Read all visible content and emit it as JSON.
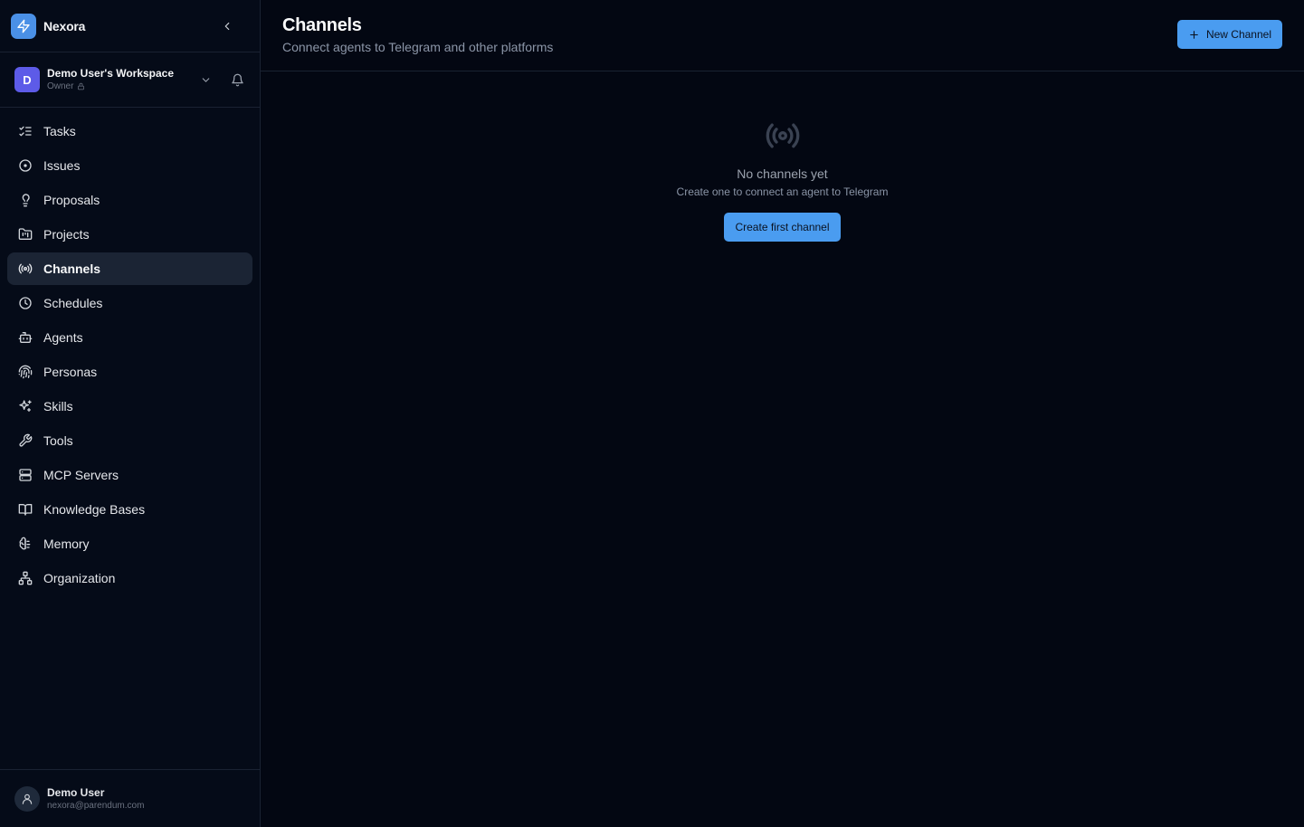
{
  "brand": {
    "name": "Nexora"
  },
  "workspace": {
    "name": "Demo User's Workspace",
    "role": "Owner",
    "initial": "D"
  },
  "nav": {
    "items": [
      {
        "label": "Tasks",
        "icon": "list-checks-icon"
      },
      {
        "label": "Issues",
        "icon": "circle-dot-icon"
      },
      {
        "label": "Proposals",
        "icon": "lightbulb-icon"
      },
      {
        "label": "Projects",
        "icon": "folder-kanban-icon"
      },
      {
        "label": "Channels",
        "icon": "radio-icon",
        "active": true
      },
      {
        "label": "Schedules",
        "icon": "clock-icon"
      },
      {
        "label": "Agents",
        "icon": "bot-icon"
      },
      {
        "label": "Personas",
        "icon": "fingerprint-icon"
      },
      {
        "label": "Skills",
        "icon": "sparkles-icon"
      },
      {
        "label": "Tools",
        "icon": "wrench-icon"
      },
      {
        "label": "MCP Servers",
        "icon": "server-icon"
      },
      {
        "label": "Knowledge Bases",
        "icon": "book-open-icon"
      },
      {
        "label": "Memory",
        "icon": "brain-icon"
      },
      {
        "label": "Organization",
        "icon": "network-icon"
      }
    ]
  },
  "user": {
    "name": "Demo User",
    "email": "nexora@parendum.com"
  },
  "header": {
    "title": "Channels",
    "subtitle": "Connect agents to Telegram and other platforms",
    "new_button_label": "New Channel"
  },
  "empty_state": {
    "title": "No channels yet",
    "description": "Create one to connect an agent to Telegram",
    "button_label": "Create first channel"
  },
  "colors": {
    "accent": "#4a9cf0",
    "background": "#030712",
    "sidebar": "#050b18",
    "workspace_avatar": "#5d5be8"
  }
}
